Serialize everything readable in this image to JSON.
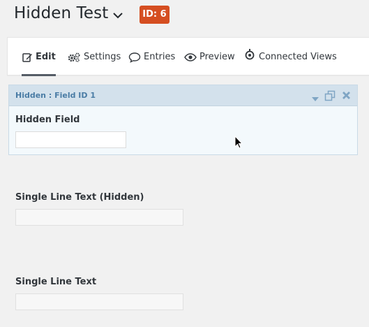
{
  "header": {
    "title": "Hidden Test",
    "id_badge": "ID: 6"
  },
  "nav": {
    "items": [
      {
        "label": "Edit",
        "icon": "edit-icon",
        "active": true
      },
      {
        "label": "Settings",
        "icon": "gears-icon",
        "active": false
      },
      {
        "label": "Entries",
        "icon": "speech-bubble-icon",
        "active": false
      },
      {
        "label": "Preview",
        "icon": "eye-icon",
        "active": false
      },
      {
        "label": "Connected Views",
        "icon": "gravityview-icon",
        "active": false
      }
    ]
  },
  "fields": {
    "selected": {
      "header": "Hidden : Field ID 1",
      "label": "Hidden Field",
      "value": ""
    },
    "single_line_hidden": {
      "label": "Single Line Text (Hidden)",
      "value": ""
    },
    "single_line": {
      "label": "Single Line Text",
      "value": ""
    }
  },
  "colors": {
    "badge": "#d54e21",
    "panel_header": "#d3e1ec",
    "panel_title": "#4a7ca5"
  }
}
